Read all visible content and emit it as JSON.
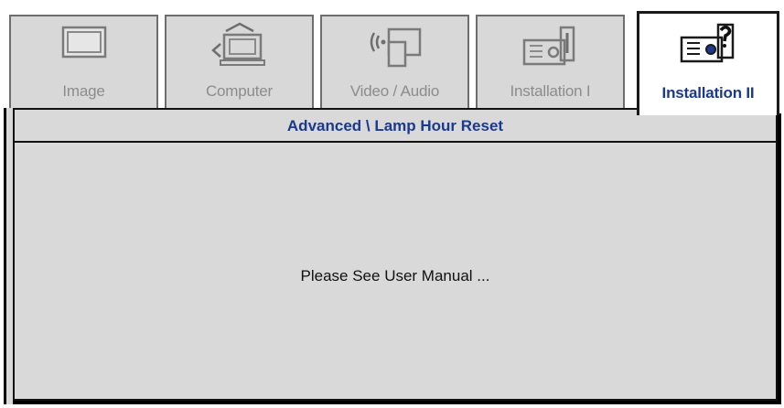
{
  "tabs": [
    {
      "label": "Image",
      "icon": "monitor-icon",
      "active": false
    },
    {
      "label": "Computer",
      "icon": "computer-icon",
      "active": false
    },
    {
      "label": "Video / Audio",
      "icon": "video-audio-icon",
      "active": false
    },
    {
      "label": "Installation I",
      "icon": "projector-icon",
      "active": false
    },
    {
      "label": "Installation II",
      "icon": "projector-help-icon",
      "active": true
    }
  ],
  "breadcrumb": "Advanced \\ Lamp Hour Reset",
  "message": "Please See User Manual ...",
  "colors": {
    "accent_text": "#1b3a8c",
    "panel_bg": "#d9d9d9",
    "inactive_label": "#8c8c8c"
  }
}
